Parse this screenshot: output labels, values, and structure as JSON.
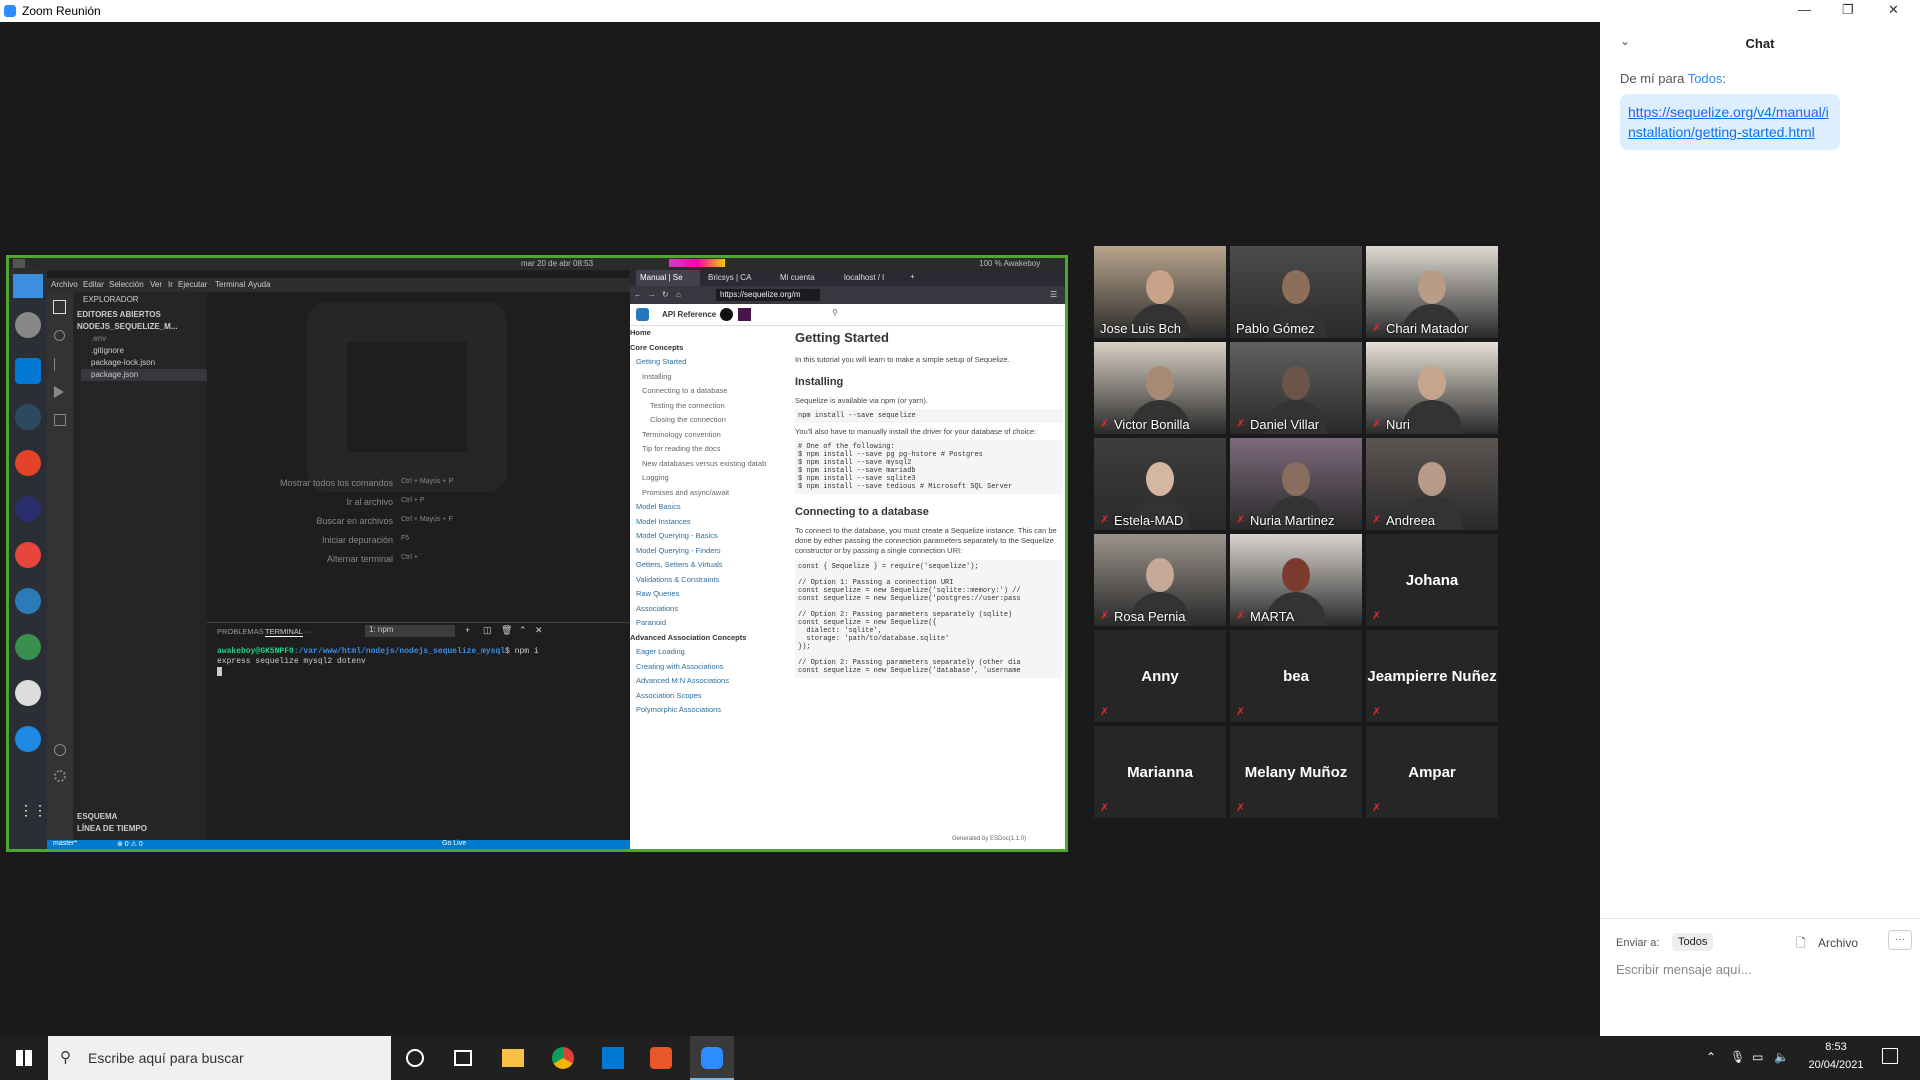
{
  "window": {
    "title": "Zoom Reunión"
  },
  "remote": {
    "topbar_date": "mar 20 de abr  08:53",
    "topbar_status": "100 %  Awakeboy",
    "vscode": {
      "menu": [
        "Archivo",
        "Editar",
        "Selección",
        "Ver",
        "Ir",
        "Ejecutar",
        "Terminal",
        "Ayuda"
      ],
      "explorer_title": "EXPLORADOR",
      "open_editors": "EDITORES ABIERTOS",
      "project": "NODEJS_SEQUELIZE_M...",
      "files": [
        ".env",
        ".gitignore",
        "package-lock.json",
        "package.json"
      ],
      "outline": "ESQUEMA",
      "timeline": "LÍNEA DE TIEMPO",
      "shortcuts": [
        {
          "label": "Mostrar todos los comandos",
          "keys": "Ctrl + Mayús + P"
        },
        {
          "label": "Ir al archivo",
          "keys": "Ctrl + P"
        },
        {
          "label": "Buscar en archivos",
          "keys": "Ctrl + Mayús + F"
        },
        {
          "label": "Iniciar depuración",
          "keys": "F5"
        },
        {
          "label": "Alternar terminal",
          "keys": "Ctrl + `"
        }
      ],
      "panel_tabs": [
        "PROBLEMAS",
        "TERMINAL",
        "···"
      ],
      "terminal_select": "1: npm",
      "prompt": "awakeboy@GK5NPF0",
      "path": ":/var/www/html/nodejs/nodejs_sequelize_mysql",
      "command": "$ npm i express sequelize mysql2 dotenv",
      "status_branch": "master*",
      "status_errors": "⊗ 0 ⚠ 0",
      "status_golive": "Go Live"
    },
    "browser": {
      "tabs": [
        "Manual | Se",
        "Bricsys | CA",
        "Mi cuenta",
        "localhost / l"
      ],
      "url": "https://sequelize.org/m",
      "api_ref": "API Reference",
      "sidebar": [
        "Home",
        "Core Concepts",
        "Getting Started",
        "Installing",
        "Connecting to a database",
        "Testing the connection",
        "Closing the connection",
        "Terminology convention",
        "Tip for reading the docs",
        "New databases versus existing datab",
        "Logging",
        "Promises and async/await",
        "Model Basics",
        "Model Instances",
        "Model Querying - Basics",
        "Model Querying - Finders",
        "Getters, Setters & Virtuals",
        "Validations & Constraints",
        "Raw Queries",
        "Associations",
        "Paranoid",
        "Advanced Association Concepts",
        "Eager Loading",
        "Creating with Associations",
        "Advanced M:N Associations",
        "Association Scopes",
        "Polymorphic Associations"
      ],
      "h1": "Getting Started",
      "intro": "In this tutorial you will learn to make a simple setup of Sequelize.",
      "h2_install": "Installing",
      "install_text": "Sequelize is available via npm (or yarn).",
      "install_cmd": "npm install --save sequelize",
      "driver_text": "You'll also have to manually install the driver for your database of choice:",
      "driver_code": "# One of the following:\n$ npm install --save pg pg-hstore # Postgres\n$ npm install --save mysql2\n$ npm install --save mariadb\n$ npm install --save sqlite3\n$ npm install --save tedious # Microsoft SQL Server",
      "h2_connect": "Connecting to a database",
      "connect_text": "To connect to the database, you must create a Sequelize instance. This can be done by either passing the connection parameters separately to the Sequelize constructor or by passing a single connection URI:",
      "connect_code": "const { Sequelize } = require('sequelize');\n\n// Option 1: Passing a connection URI\nconst sequelize = new Sequelize('sqlite::memory:') //\nconst sequelize = new Sequelize('postgres://user:pass\n\n// Option 2: Passing parameters separately (sqlite)\nconst sequelize = new Sequelize({\n  dialect: 'sqlite',\n  storage: 'path/to/database.sqlite'\n});\n\n// Option 2: Passing parameters separately (other dia\nconst sequelize = new Sequelize('database', 'username",
      "footer": "Generated by ESDoc(1.1.0)"
    }
  },
  "participants": [
    {
      "name": "Jose Luis Bch",
      "video": true,
      "muted": false,
      "active": true
    },
    {
      "name": "Pablo Gómez",
      "video": true,
      "muted": false
    },
    {
      "name": "Chari Matador",
      "video": true,
      "muted": true
    },
    {
      "name": "Victor Bonilla",
      "video": true,
      "muted": true
    },
    {
      "name": "Daniel Villar",
      "video": true,
      "muted": true
    },
    {
      "name": "Nuri",
      "video": true,
      "muted": true
    },
    {
      "name": "Estela-MAD",
      "video": true,
      "muted": true
    },
    {
      "name": "Nuria Martinez",
      "video": true,
      "muted": true
    },
    {
      "name": "Andreea",
      "video": true,
      "muted": true
    },
    {
      "name": "Rosa Pernia",
      "video": true,
      "muted": true
    },
    {
      "name": "MARTA",
      "video": true,
      "muted": true
    },
    {
      "name": "Johana",
      "video": false,
      "muted": true
    },
    {
      "name": "Anny",
      "video": false,
      "muted": true
    },
    {
      "name": "bea",
      "video": false,
      "muted": true
    },
    {
      "name": "Jeampierre Nuñez",
      "video": false,
      "muted": true
    },
    {
      "name": "Marianna",
      "video": false,
      "muted": true
    },
    {
      "name": "Melany Muñoz",
      "video": false,
      "muted": true
    },
    {
      "name": "Ampar",
      "video": false,
      "muted": true
    }
  ],
  "chat": {
    "title": "Chat",
    "from_prefix": "De mí para ",
    "from_target": "Todos",
    "from_suffix": ":",
    "message": "https://sequelize.org/v4/manual/installation/getting-started.html",
    "send_to_label": "Enviar a:",
    "send_to_value": "Todos",
    "file_label": "Archivo",
    "more_label": "···",
    "input_placeholder": "Escribir mensaje aquí..."
  },
  "taskbar": {
    "search_placeholder": "Escribe aquí para buscar",
    "time": "8:53",
    "date": "20/04/2021"
  }
}
